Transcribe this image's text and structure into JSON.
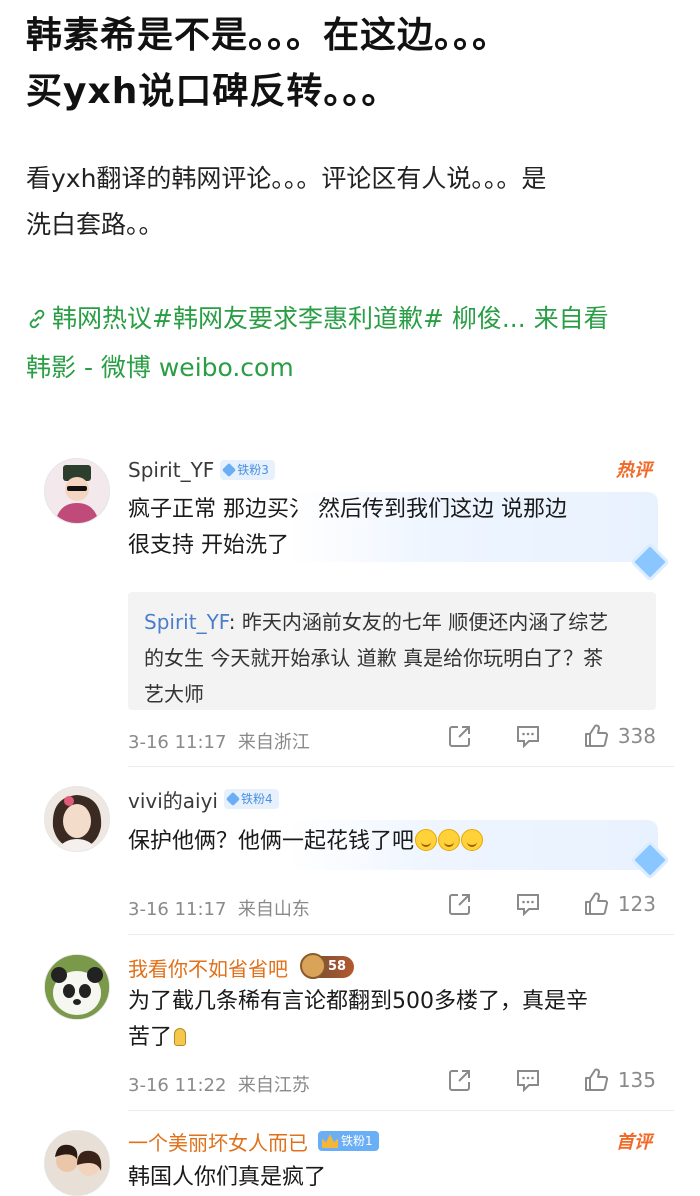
{
  "post": {
    "title_line1": "韩素希是不是。。。在这边。。。",
    "title_line2": "买yxh说口碑反转。。。",
    "body_line1": "看yxh翻译的韩网评论。。。评论区有人说。。。是",
    "body_line2": "洗白套路。。",
    "link_line1": "韩网热议#韩网友要求李惠利道歉# 柳俊... 来自看",
    "link_line2": "韩影 - 微博 weibo.com"
  },
  "comments": [
    {
      "author": "Spirit_YF",
      "badge": "铁粉3",
      "tag": "热评",
      "text_line1": "疯子正常 那边买氵 然后传到我们这边 说那边",
      "text_line2": "很支持 开始洗了",
      "quote": {
        "name": "Spirit_YF",
        "text_line1": ": 昨天内涵前女友的七年 顺便还内涵了综艺",
        "text_line2": "的女生 今天就开始承认 道歉 真是给你玩明白了？茶",
        "text_line3": "艺大师"
      },
      "time": "3-16 11:17",
      "location": "来自浙江",
      "likes": "338"
    },
    {
      "author": "vivi的aiyi",
      "badge": "铁粉4",
      "text": "保护他俩？他俩一起花钱了吧",
      "time": "3-16 11:17",
      "location": "来自山东",
      "likes": "123"
    },
    {
      "author": "我看你不如省省吧",
      "badge": "58",
      "text_line1": "为了截几条稀有言论都翻到500多楼了，真是辛",
      "text_line2": "苦了",
      "time": "3-16 11:22",
      "location": "来自江苏",
      "likes": "135"
    },
    {
      "author": "一个美丽坏女人而已",
      "badge": "铁粉1",
      "tag": "首评",
      "text": "韩国人你们真是疯了"
    }
  ],
  "colors": {
    "link_green": "#2a9e45",
    "hot_tag": "#f06a2a",
    "quote_name_blue": "#4a7fc8",
    "author_orange": "#e0701a"
  },
  "icons": [
    "link-icon",
    "share-icon",
    "comment-icon",
    "like-icon",
    "diamond-icon",
    "cookie-icon",
    "crown-icon"
  ]
}
